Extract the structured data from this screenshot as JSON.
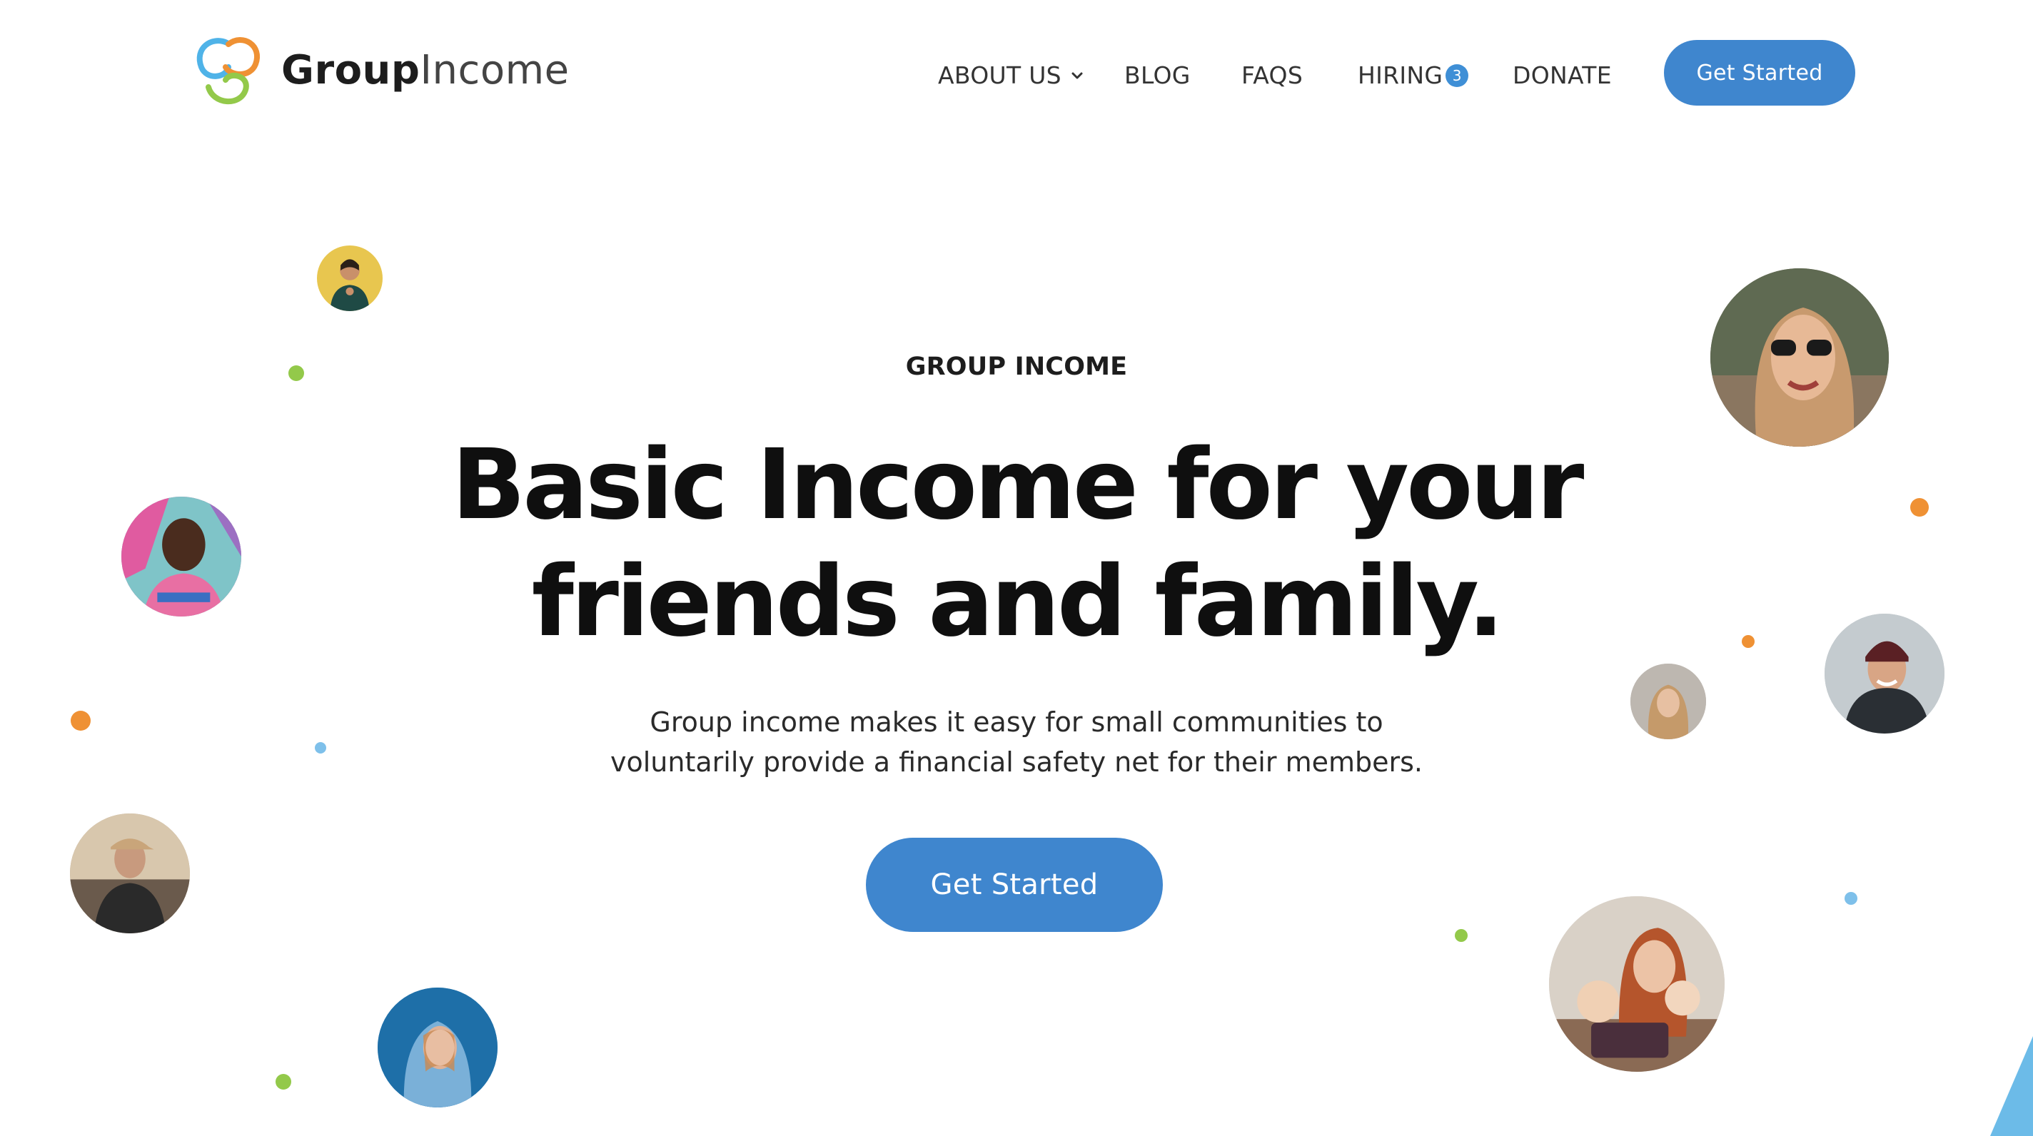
{
  "brand": {
    "name_part1": "Group",
    "name_part2": "Income",
    "logo_icon": "group-income-logo-icon"
  },
  "nav": {
    "items": [
      {
        "label": "ABOUT US",
        "has_dropdown": true
      },
      {
        "label": "BLOG"
      },
      {
        "label": "FAQS"
      },
      {
        "label": "HIRING",
        "badge": "3"
      },
      {
        "label": "DONATE"
      }
    ],
    "cta_label": "Get Started"
  },
  "hero": {
    "eyebrow": "GROUP INCOME",
    "title_line1": "Basic Income for your",
    "title_line2": "friends and family.",
    "subtitle_line1": "Group income makes it easy for small communities to",
    "subtitle_line2": "voluntarily provide a financial safety net for their members.",
    "cta_label": "Get Started"
  },
  "colors": {
    "accent_blue": "#3f86ce",
    "dot_green": "#93c94a",
    "dot_orange": "#ef9134",
    "dot_blue": "#7ec0ea"
  }
}
